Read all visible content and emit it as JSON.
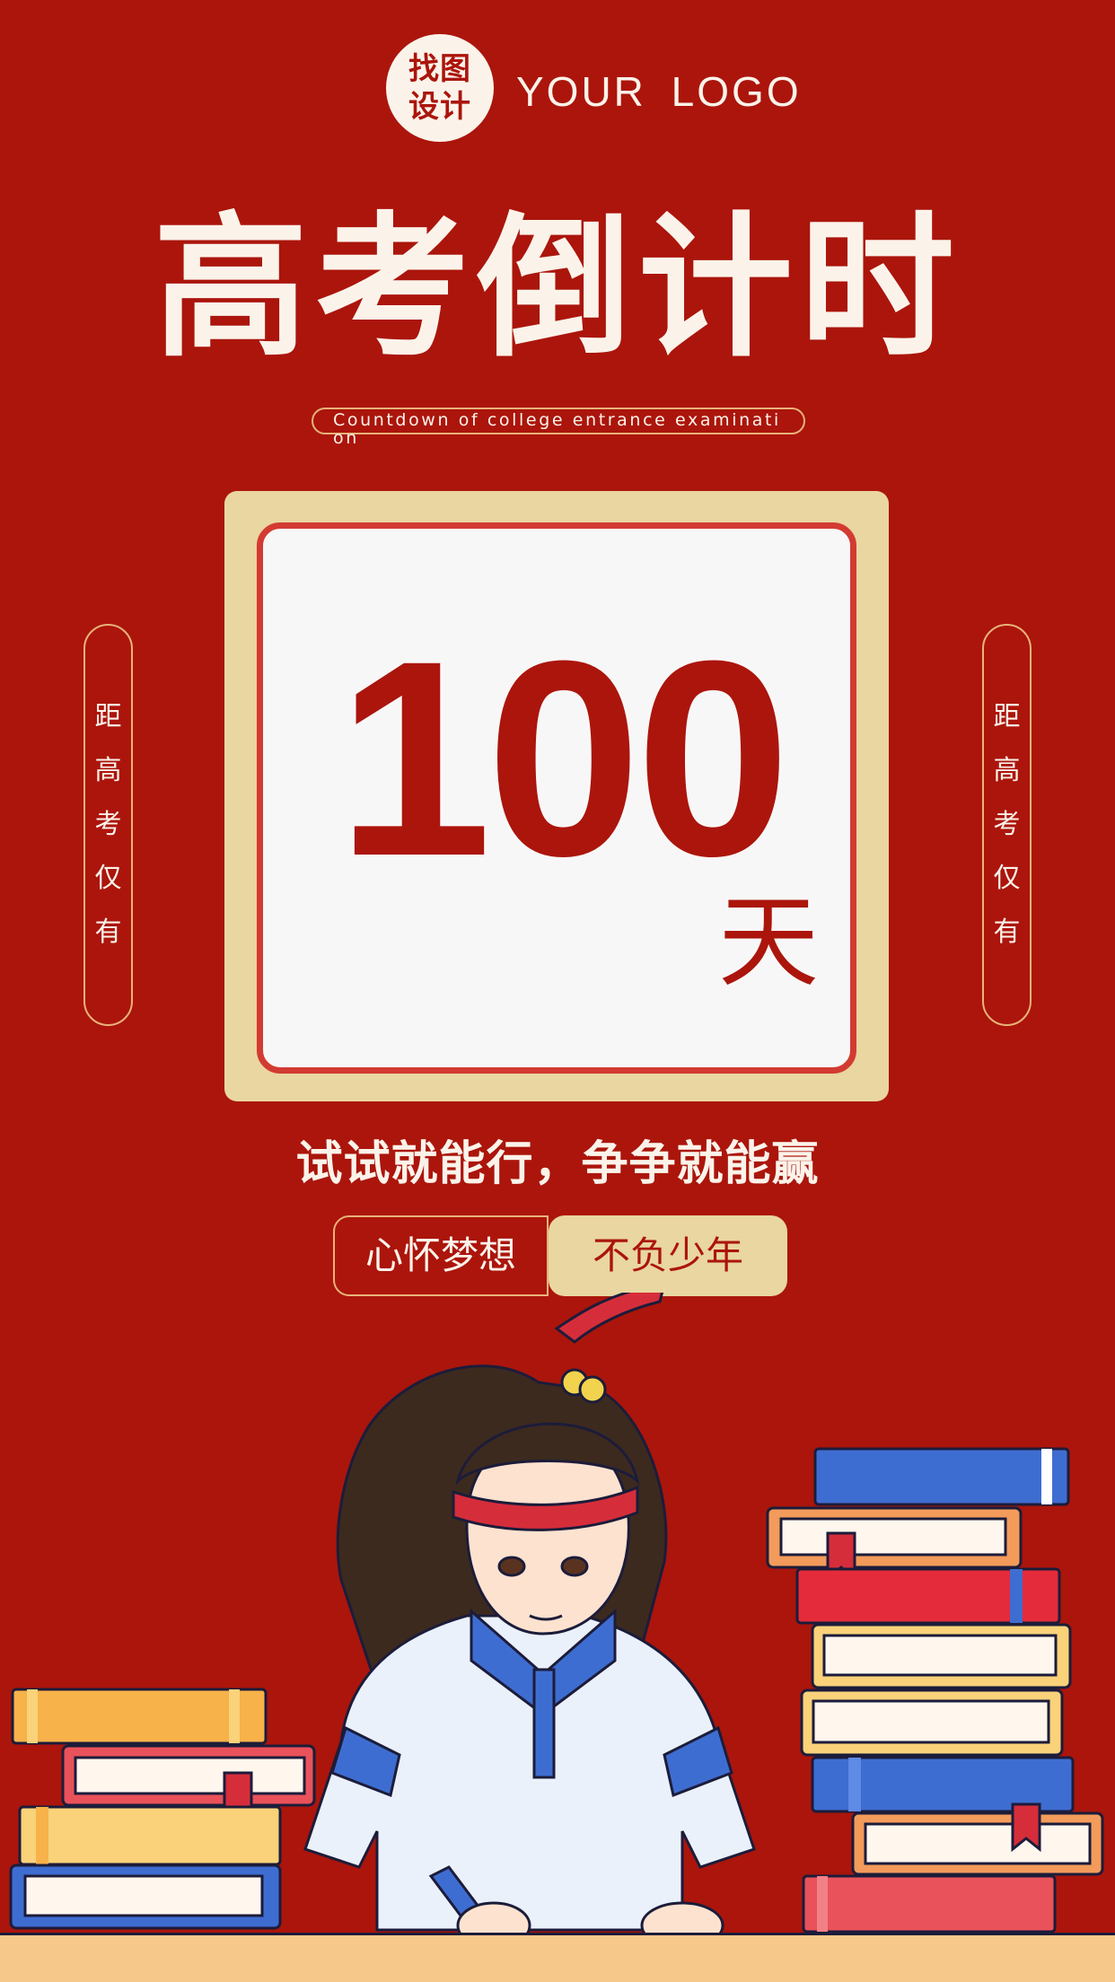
{
  "logo": {
    "badge": [
      "找图",
      "设计"
    ],
    "text": "YOUR LOGO"
  },
  "title": "高考倒计时",
  "subtitle": "Countdown of college entrance examination",
  "countdown": {
    "number": "100",
    "unit": "天"
  },
  "side_labels": {
    "left": "距高考仅有",
    "right": "距高考仅有"
  },
  "slogan": "试试就能行，争争就能赢",
  "tags": {
    "left": "心怀梦想",
    "right": "不负少年"
  },
  "colors": {
    "background": "#ab150c",
    "cream": "#fbf3ea",
    "gold": "#e9d6a0",
    "accent_border": "#d33b32"
  }
}
